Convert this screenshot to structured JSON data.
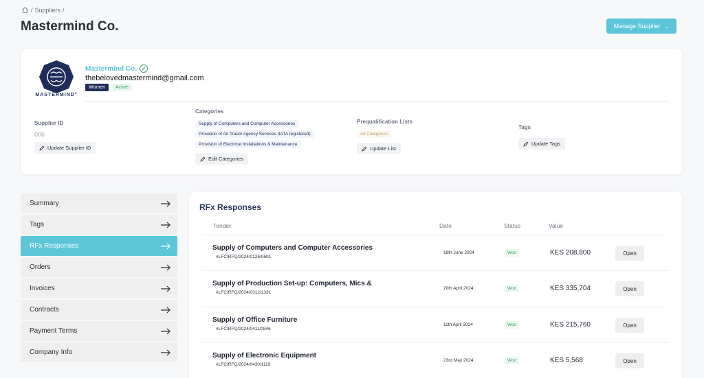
{
  "breadcrumb": {
    "separator": "/",
    "items": [
      "Suppliers"
    ],
    "trailing": "/"
  },
  "page": {
    "title": "Mastermind Co."
  },
  "header": {
    "manage_label": "Manage Supplier"
  },
  "supplier": {
    "logo_text": "MASTERMIND°",
    "name": "Mastermind Co.",
    "email": "thebelovedmastermind@gmail.com",
    "badge_group": "Women",
    "badge_status": "Active",
    "id_label": "Supplier ID",
    "id_value": "006",
    "update_id_label": "Update Supplier ID",
    "categories_label": "Categories",
    "categories": [
      "Supply of Computers and Computer Accessories",
      "Provision of Air Travel Agency Services (IATA registered)",
      "Provision of Electrical Installations & Maintenance"
    ],
    "edit_categories_label": "Edit Categories",
    "prequal_label": "Prequalification Lists",
    "prequal_chip": "All Categories",
    "update_list_label": "Update List",
    "tags_label": "Tags",
    "update_tags_label": "Update Tags"
  },
  "menu": {
    "items": [
      {
        "label": "Summary",
        "active": false
      },
      {
        "label": "Tags",
        "active": false
      },
      {
        "label": "RFx Responses",
        "active": true
      },
      {
        "label": "Orders",
        "active": false
      },
      {
        "label": "Invoices",
        "active": false
      },
      {
        "label": "Contracts",
        "active": false
      },
      {
        "label": "Payment Terms",
        "active": false
      },
      {
        "label": "Company Info",
        "active": false
      }
    ]
  },
  "rfx": {
    "title": "RFx Responses",
    "columns": {
      "tender": "Tender",
      "date": "Date",
      "status": "Status",
      "value": "Value"
    },
    "open_label": "Open",
    "rows": [
      {
        "title": "Supply of Computers and Computer Accessories",
        "ref": "#LFC/RFQ/2024/0126/0601",
        "date": "18th June 2024",
        "status": "Won",
        "value": "KES 208,800"
      },
      {
        "title": "Supply of Production Set-up: Computers, Mics &",
        "ref": "#LFC/RFQ/2024/0312/1331",
        "date": "20th April 2024",
        "status": "Won",
        "value": "KES 335,704"
      },
      {
        "title": "Supply of Office Furniture",
        "ref": "#LFC/RFQ/2024/0411/0846",
        "date": "11th April 2024",
        "status": "Won",
        "value": "KES 215,760"
      },
      {
        "title": "Supply of Electronic Equipment",
        "ref": "#LFC/RFQ/2024/0430/1119",
        "date": "23rd May 2024",
        "status": "Won",
        "value": "KES 5,568"
      }
    ]
  },
  "colors": {
    "accent": "#5cc6d8",
    "navy": "#1f2d5a",
    "success": "#3aa36b"
  },
  "icons": [
    "home-icon",
    "check-circle-icon",
    "pencil-icon",
    "arrow-right-icon",
    "chevron-down-icon"
  ]
}
